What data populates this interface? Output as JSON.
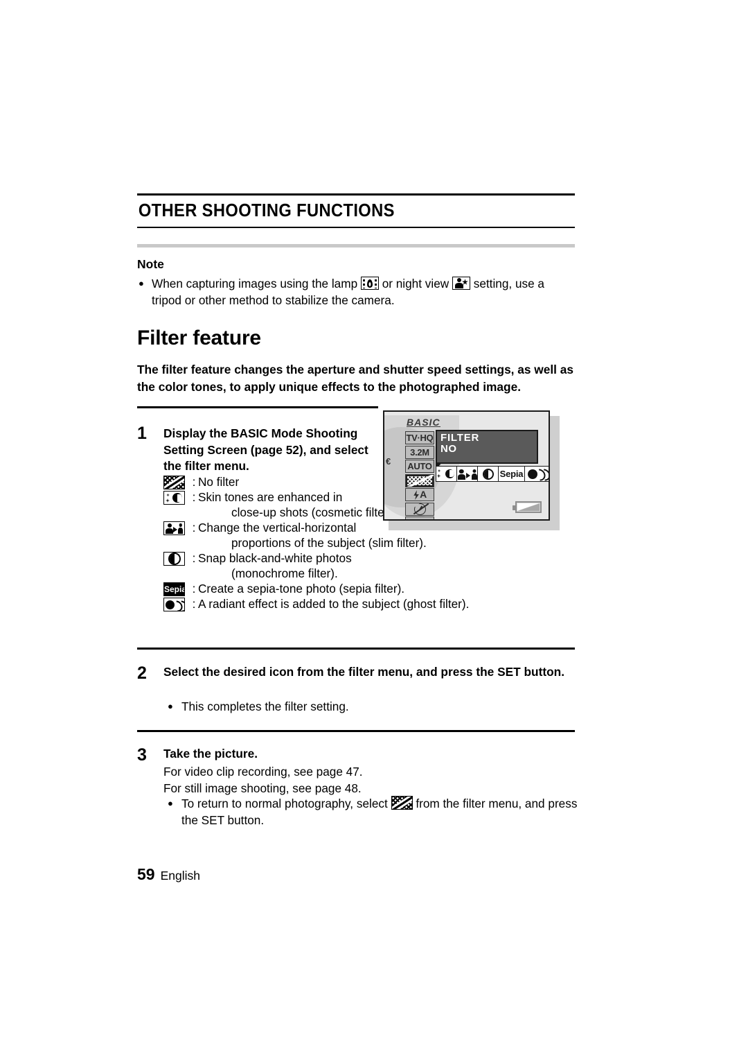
{
  "chapter": {
    "title": "OTHER SHOOTING FUNCTIONS"
  },
  "note": {
    "label": "Note",
    "text_part1": "When capturing images using the lamp",
    "icon_lamp": "lamp-icon",
    "text_part2": "or night view",
    "icon_night": "night-view-icon",
    "text_part3": "setting, use a tripod or other method to stabilize the camera."
  },
  "section": {
    "heading": "Filter feature",
    "intro": "The filter feature changes the aperture and shutter speed settings, as well as the color tones, to apply unique effects to the photographed image."
  },
  "steps": [
    {
      "number": "1",
      "heading": "Display the BASIC Mode Shooting Setting Screen (page 52), and select the filter menu."
    },
    {
      "number": "2",
      "heading": "Select the desired icon from the filter menu, and press the SET button.",
      "bullet": "This completes the filter setting."
    },
    {
      "number": "3",
      "heading": "Take the picture.",
      "line1": "For video clip recording, see page 47.",
      "line2": "For still image shooting, see page 48.",
      "bullet_part1": "To return to normal photography, select",
      "bullet_icon": "no-filter-icon",
      "bullet_part2": "from the filter menu, and press the SET button."
    }
  ],
  "filter_list": [
    {
      "icon": "no-filter-icon",
      "colon": ":",
      "text": "No filter",
      "cont": ""
    },
    {
      "icon": "cosmetic-filter-icon",
      "colon": ":",
      "text": "Skin tones are enhanced in",
      "cont": "close-up shots (cosmetic filter)."
    },
    {
      "icon": "slim-filter-icon",
      "colon": ":",
      "text": "Change the vertical-horizontal",
      "cont": "proportions of the subject (slim filter)."
    },
    {
      "icon": "monochrome-filter-icon",
      "colon": ":",
      "text": "Snap black-and-white photos",
      "cont": "(monochrome filter)."
    },
    {
      "icon": "sepia-filter-icon",
      "colon": ":",
      "text": "Create a sepia-tone photo (sepia filter).",
      "cont": ""
    },
    {
      "icon": "ghost-filter-icon",
      "colon": ":",
      "text": "A radiant effect is added to the subject (ghost filter).",
      "cont": ""
    }
  ],
  "camera_screen": {
    "mode_badge": "BASIC",
    "dial_mark": "€",
    "sidebar": [
      {
        "name": "resolution-tv-hq",
        "label": "TV·HQ"
      },
      {
        "name": "image-size-3-2m",
        "label": "3.2M"
      },
      {
        "name": "iso-auto",
        "label": "AUTO"
      },
      {
        "name": "filter-no-filter",
        "label": ""
      },
      {
        "name": "flash-auto",
        "label": "A"
      },
      {
        "name": "self-timer",
        "label": ""
      },
      {
        "name": "setup-wrench",
        "label": ""
      }
    ],
    "popup": {
      "title": "FILTER",
      "value": "NO"
    },
    "filter_strip": [
      {
        "name": "strip-no-filter",
        "label": ""
      },
      {
        "name": "strip-cosmetic",
        "label": ""
      },
      {
        "name": "strip-slim",
        "label": ""
      },
      {
        "name": "strip-monochrome",
        "label": ""
      },
      {
        "name": "strip-sepia",
        "label": "Sepia"
      },
      {
        "name": "strip-ghost",
        "label": ""
      }
    ],
    "battery": "battery-icon"
  },
  "footer": {
    "page_number": "59",
    "language": "English"
  }
}
